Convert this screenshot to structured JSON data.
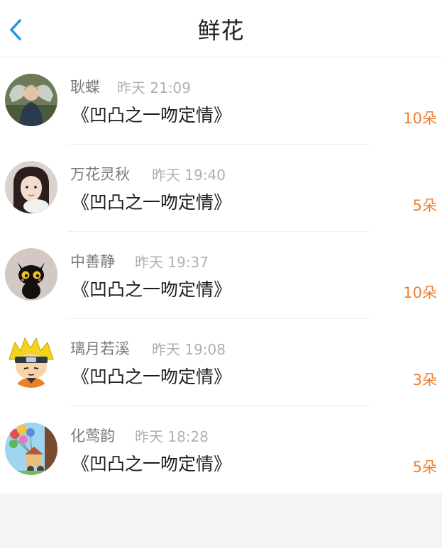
{
  "header": {
    "title": "鲜花",
    "back_icon": "chevron-left-icon",
    "accent_color": "#1a97e6"
  },
  "rows": [
    {
      "name": "耿蝶",
      "time": "昨天 21:09",
      "book": "《凹凸之一吻定情》",
      "count": "10朵",
      "avatar_icon": "avatar-photo-man-with-wings"
    },
    {
      "name": "万花灵秋",
      "time": "昨天 19:40",
      "book": "《凹凸之一吻定情》",
      "count": "5朵",
      "avatar_icon": "avatar-photo-girl"
    },
    {
      "name": "中善静",
      "time": "昨天 19:37",
      "book": "《凹凸之一吻定情》",
      "count": "10朵",
      "avatar_icon": "avatar-black-cat"
    },
    {
      "name": "璃月若溪",
      "time": "昨天 19:08",
      "book": "《凹凸之一吻定情》",
      "count": "3朵",
      "avatar_icon": "avatar-anime-ninja"
    },
    {
      "name": "化莺韵",
      "time": "昨天 18:28",
      "book": "《凹凸之一吻定情》",
      "count": "5朵",
      "avatar_icon": "avatar-balloons-house"
    }
  ],
  "colors": {
    "count": "#ef7f2e",
    "name": "#7a7a7a",
    "time": "#b0b0b0",
    "book": "#1c1c1c"
  }
}
